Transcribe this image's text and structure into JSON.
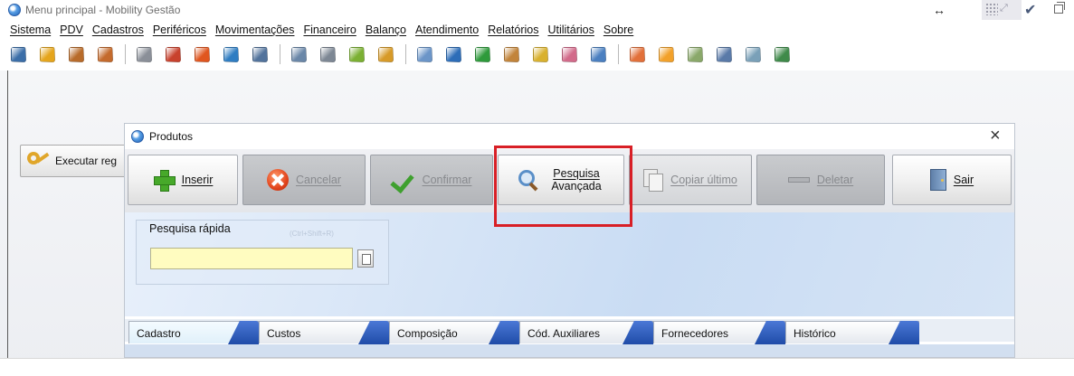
{
  "main_window": {
    "title": "Menu principal - Mobility Gestão"
  },
  "menu": {
    "items": [
      {
        "label": "Sistema"
      },
      {
        "label": "PDV"
      },
      {
        "label": "Cadastros"
      },
      {
        "label": "Periféricos"
      },
      {
        "label": "Movimentações"
      },
      {
        "label": "Financeiro"
      },
      {
        "label": "Balanço"
      },
      {
        "label": "Atendimento"
      },
      {
        "label": "Relatórios"
      },
      {
        "label": "Utilitários"
      },
      {
        "label": "Sobre"
      }
    ]
  },
  "toolbar": {
    "icons": [
      {
        "name": "door-icon",
        "color": "#3b6ea8"
      },
      {
        "name": "person-yellow-icon",
        "color": "#e5a51c"
      },
      {
        "name": "person-brown-icon",
        "color": "#b86b2a"
      },
      {
        "name": "person-edit-icon",
        "color": "#c46a2c"
      },
      {
        "sep": true
      },
      {
        "name": "screen-icon",
        "color": "#8a8f98"
      },
      {
        "name": "users-group-icon",
        "color": "#c8412d"
      },
      {
        "name": "people-icon",
        "color": "#e0561f"
      },
      {
        "name": "hierarchy-icon",
        "color": "#2f7dc2"
      },
      {
        "name": "grid-icon",
        "color": "#52739c"
      },
      {
        "sep": true
      },
      {
        "name": "chart-icon",
        "color": "#6a87a8"
      },
      {
        "name": "list-icon",
        "color": "#7d8794"
      },
      {
        "name": "palette-icon",
        "color": "#7bb033"
      },
      {
        "name": "folder-edit-icon",
        "color": "#d79a28"
      },
      {
        "sep": true
      },
      {
        "name": "card-icon",
        "color": "#6b95c8"
      },
      {
        "name": "bell-icon",
        "color": "#2d6db8"
      },
      {
        "name": "money-icon",
        "color": "#2e9a3b"
      },
      {
        "name": "calculator-icon",
        "color": "#c2843a"
      },
      {
        "name": "pen-icon",
        "color": "#d9b12e"
      },
      {
        "name": "signal-icon",
        "color": "#d26a8a"
      },
      {
        "name": "document-edit-icon",
        "color": "#4a7fc0"
      },
      {
        "sep": true
      },
      {
        "name": "gift-icon",
        "color": "#e2703a"
      },
      {
        "name": "fruit-icon",
        "color": "#f2a12a"
      },
      {
        "name": "leaf-icon",
        "color": "#8aa86a"
      },
      {
        "name": "signature-icon",
        "color": "#5a7aa8"
      },
      {
        "name": "printer-icon",
        "color": "#7aa0b8"
      },
      {
        "name": "network-icon",
        "color": "#3f8a4a"
      }
    ]
  },
  "exec_button": {
    "label": "Executar reg"
  },
  "produtos": {
    "title": "Produtos",
    "buttons": {
      "inserir": "Inserir",
      "cancelar": "Cancelar",
      "confirmar": "Confirmar",
      "pesquisa_line1": "Pesquisa",
      "pesquisa_line2": "Avançada",
      "copiar": "Copiar último",
      "deletar": "Deletar",
      "sair": "Sair"
    },
    "quick_search": {
      "label": "Pesquisa rápida",
      "shortcut_hint": "(Ctrl+Shift+R)",
      "value": ""
    },
    "tabs": [
      {
        "label": "Cadastro"
      },
      {
        "label": "Custos"
      },
      {
        "label": "Composição"
      },
      {
        "label": "Cód. Auxiliares"
      },
      {
        "label": "Fornecedores"
      },
      {
        "label": "Histórico"
      }
    ]
  },
  "colors": {
    "highlight": "#d81f26",
    "input_bg": "#fffcc0",
    "tab_flap": "#1f4ca8"
  }
}
